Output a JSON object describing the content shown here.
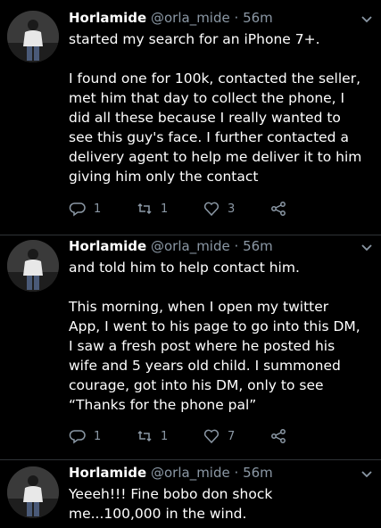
{
  "tweets": [
    {
      "name": "Horlamide",
      "handle": "@orla_mide",
      "separator": "·",
      "time": "56m",
      "paragraphs": [
        "started my search for an iPhone 7+.",
        "I found one for 100k, contacted the seller, met him that day to collect the phone, I did all these because I really wanted to see this guy's face. I further contacted a delivery agent to help me deliver it to him giving him only the contact"
      ],
      "replies": "1",
      "retweets": "1",
      "likes": "3"
    },
    {
      "name": "Horlamide",
      "handle": "@orla_mide",
      "separator": "·",
      "time": "56m",
      "paragraphs": [
        "and told him to help contact him.",
        "This morning, when I open my twitter App, I went to his page to go into this DM, I saw a fresh post where he posted his wife and 5 years old child. I summoned courage, got into his DM, only to see “Thanks for the phone pal”"
      ],
      "replies": "1",
      "retweets": "1",
      "likes": "7"
    },
    {
      "name": "Horlamide",
      "handle": "@orla_mide",
      "separator": "·",
      "time": "56m",
      "paragraphs": [
        "Yeeeh!!! Fine bobo don shock me...100,000 in the wind."
      ]
    }
  ],
  "icons": {
    "reply": "reply-icon",
    "retweet": "retweet-icon",
    "like": "heart-icon",
    "share": "share-icon",
    "more": "chevron-down-icon"
  },
  "colors": {
    "background": "#000000",
    "text": "#ffffff",
    "muted": "#8b98a5"
  }
}
